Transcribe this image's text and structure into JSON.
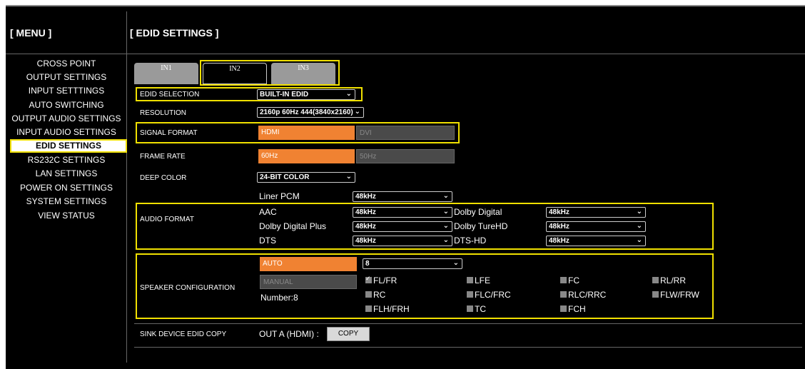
{
  "menu": {
    "header": "[ MENU ]",
    "items": [
      {
        "label": "CROSS POINT"
      },
      {
        "label": "OUTPUT SETTINGS"
      },
      {
        "label": "INPUT SETTTINGS"
      },
      {
        "label": "AUTO SWITCHING"
      },
      {
        "label": "OUTPUT AUDIO SETTINGS"
      },
      {
        "label": "INPUT AUDIO SETTINGS"
      },
      {
        "label": "EDID SETTINGS"
      },
      {
        "label": "RS232C SETTINGS"
      },
      {
        "label": "LAN SETTINGS"
      },
      {
        "label": "POWER ON SETTINGS"
      },
      {
        "label": "SYSTEM SETTINGS"
      },
      {
        "label": "VIEW STATUS"
      }
    ],
    "active_index": 6
  },
  "page": {
    "title": "[ EDID SETTINGS ]"
  },
  "tabs": [
    {
      "label": "IN1"
    },
    {
      "label": "IN2"
    },
    {
      "label": "IN3"
    }
  ],
  "edid_selection": {
    "label": "EDID SELECTION",
    "value": "BUILT-IN EDID"
  },
  "resolution": {
    "label": "RESOLUTION",
    "value": "2160p 60Hz 444(3840x2160)"
  },
  "signal_format": {
    "label": "SIGNAL FORMAT",
    "option_on": "HDMI",
    "option_off": "DVI"
  },
  "frame_rate": {
    "label": "FRAME RATE",
    "option_on": "60Hz",
    "option_off": "50Hz"
  },
  "deep_color": {
    "label": "DEEP COLOR",
    "value": "24-BIT COLOR"
  },
  "audio_format": {
    "label": "AUDIO FORMAT",
    "liner_pcm": {
      "label": "Liner PCM",
      "value": "48kHz"
    },
    "aac": {
      "label": "AAC",
      "value": "48kHz"
    },
    "dolby_digital_plus": {
      "label": "Dolby Digital Plus",
      "value": "48kHz"
    },
    "dts": {
      "label": "DTS",
      "value": "48kHz"
    },
    "dolby_digital": {
      "label": "Dolby Digital",
      "value": "48kHz"
    },
    "dolby_truehd": {
      "label": "Dolby TureHD",
      "value": "48kHz"
    },
    "dts_hd": {
      "label": "DTS-HD",
      "value": "48kHz"
    }
  },
  "speaker": {
    "label": "SPEAKER CONFIGURATION",
    "auto": "AUTO",
    "manual": "MANUAL",
    "number": "Number:8",
    "count_value": "8",
    "channels": [
      {
        "label": "FL/FR",
        "checked": true
      },
      {
        "label": "LFE",
        "checked": false
      },
      {
        "label": "FC",
        "checked": false
      },
      {
        "label": "RL/RR",
        "checked": false
      },
      {
        "label": "RC",
        "checked": false
      },
      {
        "label": "FLC/FRC",
        "checked": false
      },
      {
        "label": "RLC/RRC",
        "checked": false
      },
      {
        "label": "FLW/FRW",
        "checked": false
      },
      {
        "label": "FLH/FRH",
        "checked": false
      },
      {
        "label": "TC",
        "checked": false
      },
      {
        "label": "FCH",
        "checked": false
      }
    ]
  },
  "sink_copy": {
    "label": "SINK DEVICE EDID COPY",
    "source": "OUT A (HDMI) :",
    "button": "COPY"
  },
  "colors": {
    "accent_orange": "#f08232",
    "highlight_yellow": "#f0e000",
    "background": "#000000"
  }
}
